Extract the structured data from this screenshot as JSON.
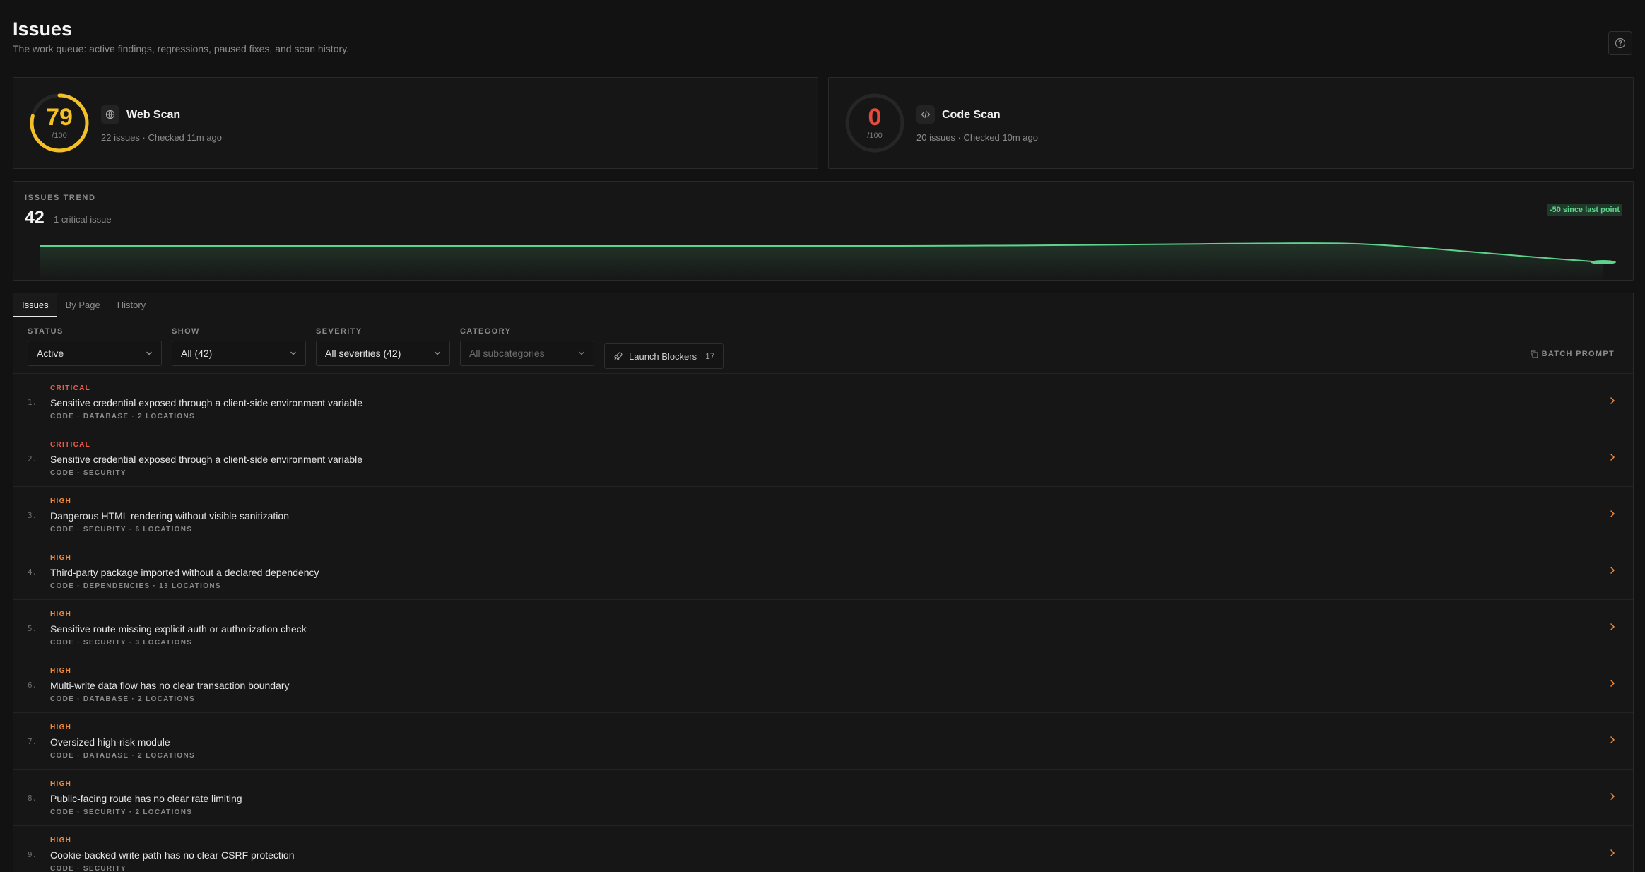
{
  "header": {
    "title": "Issues",
    "subtitle": "The work queue: active findings, regressions, paused fixes, and scan history."
  },
  "scans": [
    {
      "name": "Web Scan",
      "score": "79",
      "score_max": "/100",
      "score_fraction": 0.79,
      "meta": "22 issues · Checked 11m ago",
      "color": "#f5c026",
      "icon": "globe-icon"
    },
    {
      "name": "Code Scan",
      "score": "0",
      "score_max": "/100",
      "score_fraction": 0,
      "meta": "20 issues · Checked 10m ago",
      "color": "#ea4a3a",
      "icon": "code-icon"
    }
  ],
  "trend": {
    "label": "ISSUES TREND",
    "count": "42",
    "note": "1 critical issue",
    "delta": "-50 since last point",
    "color": "#5fd38d"
  },
  "tabs": [
    {
      "label": "Issues",
      "active": true
    },
    {
      "label": "By Page",
      "active": false
    },
    {
      "label": "History",
      "active": false
    }
  ],
  "filters": {
    "status": {
      "label": "STATUS",
      "value": "Active"
    },
    "show": {
      "label": "SHOW",
      "value": "All (42)"
    },
    "severity": {
      "label": "SEVERITY",
      "value": "All severities (42)"
    },
    "category": {
      "label": "CATEGORY",
      "placeholder": "All subcategories"
    }
  },
  "launch_blockers": {
    "label": "Launch Blockers",
    "count": "17"
  },
  "batch_prompt": {
    "label": "BATCH PROMPT"
  },
  "issues": [
    {
      "index": "1.",
      "severity": "CRITICAL",
      "title": "Sensitive credential exposed through a client-side environment variable",
      "meta": "CODE · DATABASE · 2 LOCATIONS"
    },
    {
      "index": "2.",
      "severity": "CRITICAL",
      "title": "Sensitive credential exposed through a client-side environment variable",
      "meta": "CODE · SECURITY"
    },
    {
      "index": "3.",
      "severity": "HIGH",
      "title": "Dangerous HTML rendering without visible sanitization",
      "meta": "CODE · SECURITY · 6 LOCATIONS"
    },
    {
      "index": "4.",
      "severity": "HIGH",
      "title": "Third-party package imported without a declared dependency",
      "meta": "CODE · DEPENDENCIES · 13 LOCATIONS"
    },
    {
      "index": "5.",
      "severity": "HIGH",
      "title": "Sensitive route missing explicit auth or authorization check",
      "meta": "CODE · SECURITY · 3 LOCATIONS"
    },
    {
      "index": "6.",
      "severity": "HIGH",
      "title": "Multi-write data flow has no clear transaction boundary",
      "meta": "CODE · DATABASE · 2 LOCATIONS"
    },
    {
      "index": "7.",
      "severity": "HIGH",
      "title": "Oversized high-risk module",
      "meta": "CODE · DATABASE · 2 LOCATIONS"
    },
    {
      "index": "8.",
      "severity": "HIGH",
      "title": "Public-facing route has no clear rate limiting",
      "meta": "CODE · SECURITY · 2 LOCATIONS"
    },
    {
      "index": "9.",
      "severity": "HIGH",
      "title": "Cookie-backed write path has no clear CSRF protection",
      "meta": "CODE · SECURITY"
    }
  ]
}
